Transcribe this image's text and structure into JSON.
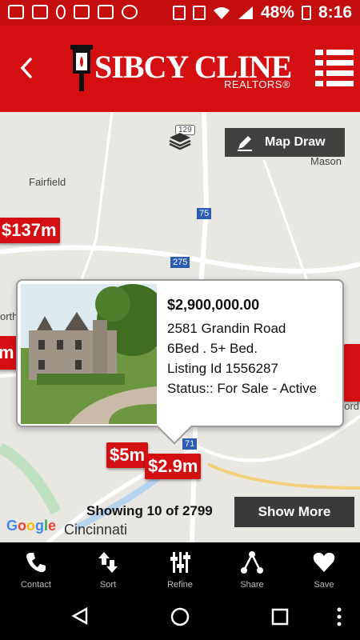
{
  "status_bar": {
    "battery": "48%",
    "time": "8:16"
  },
  "header": {
    "logo_text": "SIBCY CLINE",
    "logo_sub": "REALTORS®",
    "back_icon": "chevron-left-icon",
    "menu_icon": "list-menu-icon"
  },
  "map": {
    "labels": {
      "fairfield": "Fairfield",
      "mason": "Mason",
      "north": "orth",
      "milford": "Milford",
      "cincinnati": "Cincinnati",
      "route129": "129",
      "route75": "75",
      "route275": "275",
      "route71": "71"
    },
    "map_draw_label": "Map Draw",
    "pins": {
      "p137": "$137m",
      "pleft": "m",
      "p5": "$5m",
      "p29": "$2.9m"
    },
    "google": "Google"
  },
  "popup": {
    "price": "$2,900,000.00",
    "address": "2581 Grandin Road",
    "beds": "6Bed . 5+ Bed.",
    "listing": "Listing Id 1556287",
    "status": "Status:: For Sale - Active"
  },
  "results": {
    "showing": "Showing 10 of 2799",
    "show_more": "Show More"
  },
  "tabs": [
    {
      "label": "Contact",
      "icon": "phone-icon"
    },
    {
      "label": "Sort",
      "icon": "sort-arrows-icon"
    },
    {
      "label": "Refine",
      "icon": "sliders-icon"
    },
    {
      "label": "Share",
      "icon": "share-icon"
    },
    {
      "label": "Save",
      "icon": "heart-icon"
    }
  ]
}
